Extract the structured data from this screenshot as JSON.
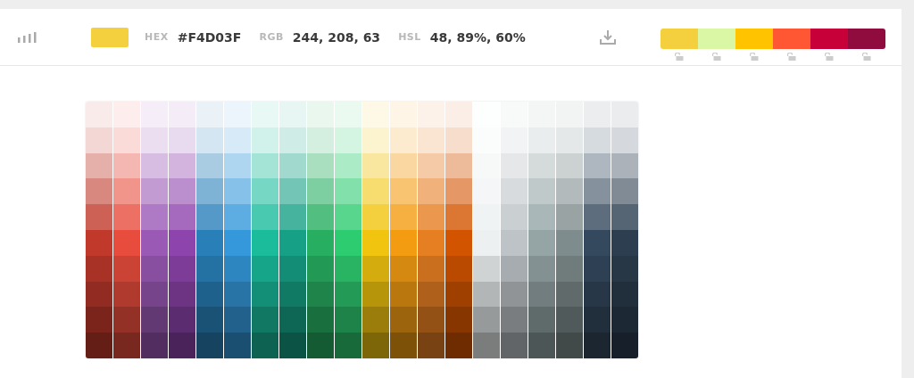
{
  "toolbar": {
    "hex_label": "HEX",
    "hex": "#F4D03F",
    "rgb_label": "RGB",
    "rgb": "244, 208, 63",
    "hsl_label": "HSL",
    "hsl": "48, 89%, 60%"
  },
  "palette": [
    {
      "color": "#f4d03f",
      "locked": false
    },
    {
      "color": "#daf7a6",
      "locked": false
    },
    {
      "color": "#ffc300",
      "locked": false
    },
    {
      "color": "#ff5733",
      "locked": false
    },
    {
      "color": "#c70039",
      "locked": false
    },
    {
      "color": "#900c3f",
      "locked": false
    }
  ],
  "grid": {
    "columns": [
      {
        "color": "#c0392b"
      },
      {
        "color": "#e74c3c"
      },
      {
        "color": "#9b59b6"
      },
      {
        "color": "#8e44ad"
      },
      {
        "color": "#2980b9"
      },
      {
        "color": "#3498db"
      },
      {
        "color": "#1abc9c"
      },
      {
        "color": "#16a085"
      },
      {
        "color": "#27ae60"
      },
      {
        "color": "#2ecc71"
      },
      {
        "color": "#f1c40f"
      },
      {
        "color": "#f39c12"
      },
      {
        "color": "#e67e22"
      },
      {
        "color": "#d35400"
      },
      {
        "color": "#ecf0f1"
      },
      {
        "color": "#bdc3c7"
      },
      {
        "color": "#95a5a6"
      },
      {
        "color": "#7f8c8d"
      },
      {
        "color": "#34495e"
      },
      {
        "color": "#2c3e50"
      }
    ]
  }
}
